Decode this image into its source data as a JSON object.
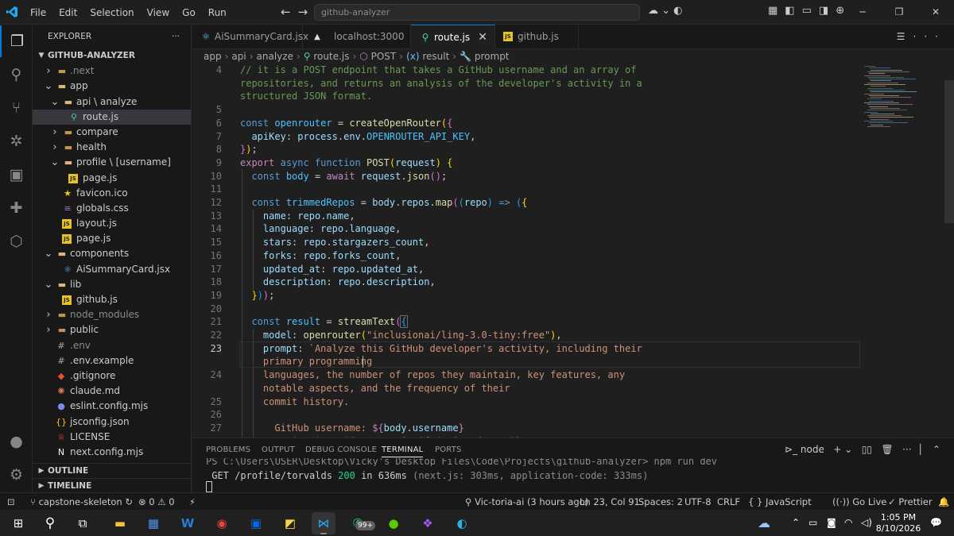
{
  "titlebar": {
    "menu": [
      "File",
      "Edit",
      "Selection",
      "View",
      "Go",
      "Run"
    ],
    "search_placeholder": "github-analyzer"
  },
  "activity_bar": {
    "icons": [
      "files-icon",
      "search-icon",
      "source-control-icon",
      "run-debug-icon",
      "remote-explorer-icon",
      "extensions-icon",
      "containers-icon",
      "account-icon",
      "settings-gear-icon"
    ]
  },
  "sidebar": {
    "title": "EXPLORER",
    "more": "···",
    "root": "GITHUB-ANALYZER",
    "tree": [
      {
        "label": ".next",
        "depth": 1,
        "kind": "folder",
        "open": false,
        "dim": true
      },
      {
        "label": "app",
        "depth": 1,
        "kind": "folder",
        "open": true
      },
      {
        "label": "api \\ analyze",
        "depth": 2,
        "kind": "folder",
        "open": true
      },
      {
        "label": "route.js",
        "depth": 3,
        "kind": "route",
        "active": true
      },
      {
        "label": "compare",
        "depth": 2,
        "kind": "folder",
        "open": false
      },
      {
        "label": "health",
        "depth": 2,
        "kind": "folder",
        "open": false
      },
      {
        "label": "profile \\ [username]",
        "depth": 2,
        "kind": "folder",
        "open": true
      },
      {
        "label": "page.js",
        "depth": 3,
        "kind": "js"
      },
      {
        "label": "favicon.ico",
        "depth": 2,
        "kind": "star"
      },
      {
        "label": "globals.css",
        "depth": 2,
        "kind": "css"
      },
      {
        "label": "layout.js",
        "depth": 2,
        "kind": "js"
      },
      {
        "label": "page.js",
        "depth": 2,
        "kind": "js"
      },
      {
        "label": "components",
        "depth": 1,
        "kind": "folder",
        "open": true
      },
      {
        "label": "AiSummaryCard.jsx",
        "depth": 2,
        "kind": "react"
      },
      {
        "label": "lib",
        "depth": 1,
        "kind": "folder",
        "open": true
      },
      {
        "label": "github.js",
        "depth": 2,
        "kind": "js"
      },
      {
        "label": "node_modules",
        "depth": 1,
        "kind": "folder",
        "open": false,
        "dim": true
      },
      {
        "label": "public",
        "depth": 1,
        "kind": "folder",
        "open": false
      },
      {
        "label": ".env",
        "depth": 1,
        "kind": "env",
        "dim": true
      },
      {
        "label": ".env.example",
        "depth": 1,
        "kind": "env"
      },
      {
        "label": ".gitignore",
        "depth": 1,
        "kind": "git"
      },
      {
        "label": "claude.md",
        "depth": 1,
        "kind": "claude"
      },
      {
        "label": "eslint.config.mjs",
        "depth": 1,
        "kind": "eslint"
      },
      {
        "label": "jsconfig.json",
        "depth": 1,
        "kind": "json"
      },
      {
        "label": "LICENSE",
        "depth": 1,
        "kind": "license"
      },
      {
        "label": "next.config.mjs",
        "depth": 1,
        "kind": "next"
      }
    ],
    "outline": "OUTLINE",
    "timeline": "TIMELINE"
  },
  "tabs": [
    {
      "label": "AiSummaryCard.jsx",
      "icon": "react-icon"
    },
    {
      "label": "localhost:3000",
      "icon": "triangle-icon"
    },
    {
      "label": "route.js",
      "icon": "route-icon",
      "active": true,
      "close": "✕"
    },
    {
      "label": "github.js",
      "icon": "js-icon"
    }
  ],
  "breadcrumb": [
    "app",
    "api",
    "analyze",
    "route.js",
    "POST",
    "result",
    "prompt"
  ],
  "editor": {
    "line_numbers": [
      "4",
      "",
      "",
      "5",
      "6",
      "7",
      "8",
      "9",
      "10",
      "11",
      "12",
      "13",
      "14",
      "15",
      "16",
      "17",
      "18",
      "19",
      "20",
      "21",
      "22",
      "23",
      "",
      "24",
      "",
      "25",
      "26",
      "27"
    ],
    "current_line": "23"
  },
  "panel": {
    "tabs": [
      "PROBLEMS",
      "OUTPUT",
      "DEBUG CONSOLE",
      "TERMINAL",
      "PORTS"
    ],
    "active_tab": "TERMINAL",
    "shell": "node",
    "term_line1": "PS C:\\Users\\USER\\Desktop\\Vicky's Desktop Files\\Code\\Projects\\github-analyzer> npm run dev",
    "term_get": " GET /profile/torvalds ",
    "term_status": "200",
    "term_in": " in 636ms ",
    "term_detail": "(next.js: 303ms, application-code: 333ms)"
  },
  "statusbar": {
    "branch": "capstone-skeleton",
    "errors": "0",
    "warnings": "0",
    "blame": "Vic-toria-ai (3 hours ago)",
    "position": "Ln 23, Col 91",
    "spaces": "Spaces: 2",
    "encoding": "UTF-8",
    "eol": "CRLF",
    "language": "JavaScript",
    "golive": "Go Live",
    "prettier": "Prettier"
  },
  "taskbar": {
    "apps": [
      "start-icon",
      "search-icon",
      "task-view-icon",
      "file-explorer-icon",
      "ms-store-icon",
      "word-icon",
      "chrome-icon",
      "trello-icon",
      "sticky-notes-icon",
      "vscode-icon",
      "whatsapp-icon",
      "duolingo-icon",
      "figma-icon",
      "edge-icon"
    ],
    "whatsapp_badge": "99+",
    "time": "1:05 PM",
    "date": "8/10/2026"
  }
}
